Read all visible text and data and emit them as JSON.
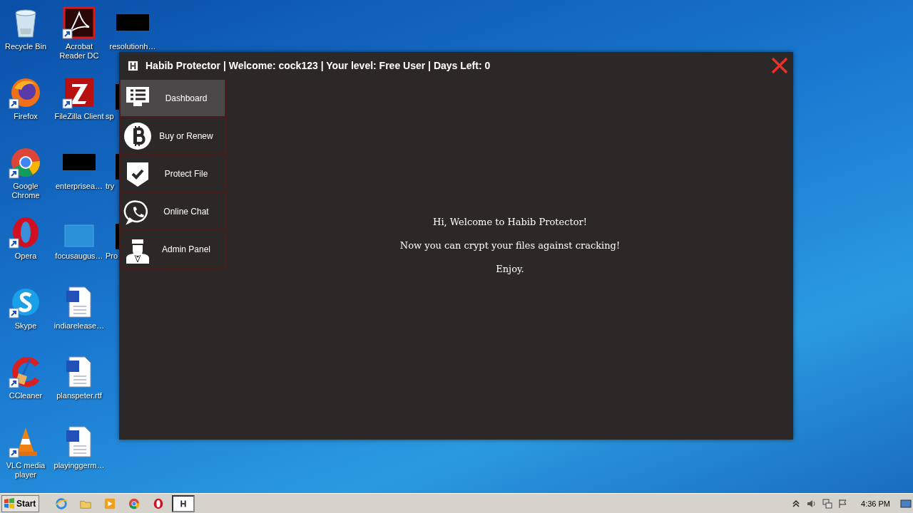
{
  "desktop": {
    "columns": [
      [
        {
          "label": "Recycle Bin",
          "kind": "recycle",
          "shortcut": false
        },
        {
          "label": "Firefox",
          "kind": "firefox",
          "shortcut": true
        },
        {
          "label": "Google Chrome",
          "kind": "chrome",
          "shortcut": true
        },
        {
          "label": "Opera",
          "kind": "opera",
          "shortcut": true
        },
        {
          "label": "Skype",
          "kind": "skype",
          "shortcut": true
        },
        {
          "label": "CCleaner",
          "kind": "ccleaner",
          "shortcut": true
        },
        {
          "label": "VLC media player",
          "kind": "vlc",
          "shortcut": true
        }
      ],
      [
        {
          "label": "Acrobat Reader DC",
          "kind": "acrobat",
          "shortcut": true
        },
        {
          "label": "FileZilla Client",
          "kind": "filezilla",
          "shortcut": true
        },
        {
          "label": "enterprisea…",
          "kind": "blackout",
          "shortcut": false
        },
        {
          "label": "focusaugus…",
          "kind": "blank",
          "shortcut": false
        },
        {
          "label": "indiarelease…",
          "kind": "word",
          "shortcut": false
        },
        {
          "label": "planspeter.rtf",
          "kind": "word",
          "shortcut": false
        },
        {
          "label": "playinggerm…",
          "kind": "word",
          "shortcut": false
        }
      ],
      [
        {
          "label": "resolutionh…",
          "kind": "blackout",
          "shortcut": false
        },
        {
          "label": "sp",
          "kind": "cut",
          "shortcut": false
        },
        {
          "label": "try",
          "kind": "cut",
          "shortcut": false
        },
        {
          "label": "Pro",
          "kind": "cut",
          "shortcut": false
        }
      ]
    ]
  },
  "window": {
    "title": "Habib Protector | Welcome: cock123 | Your level: Free User | Days Left: 0"
  },
  "sidebar": {
    "items": [
      {
        "label": "Dashboard",
        "kind": "monitor",
        "selected": true
      },
      {
        "label": "Buy or Renew",
        "kind": "coin",
        "selected": false
      },
      {
        "label": "Protect File",
        "kind": "shield",
        "selected": false
      },
      {
        "label": "Online Chat",
        "kind": "phone",
        "selected": false
      },
      {
        "label": "Admin Panel",
        "kind": "person",
        "selected": false
      }
    ]
  },
  "content": {
    "lines": [
      "Hi, Welcome to Habib Protector!",
      "Now you can crypt your files against cracking!",
      "Enjoy."
    ]
  },
  "taskbar": {
    "start": "Start",
    "apps": [
      {
        "kind": "ie",
        "active": false
      },
      {
        "kind": "folder",
        "active": false
      },
      {
        "kind": "media",
        "active": false
      },
      {
        "kind": "chrome",
        "active": false
      },
      {
        "kind": "opera",
        "active": false
      },
      {
        "kind": "habib",
        "active": true
      }
    ],
    "clock": "4:36 PM"
  }
}
